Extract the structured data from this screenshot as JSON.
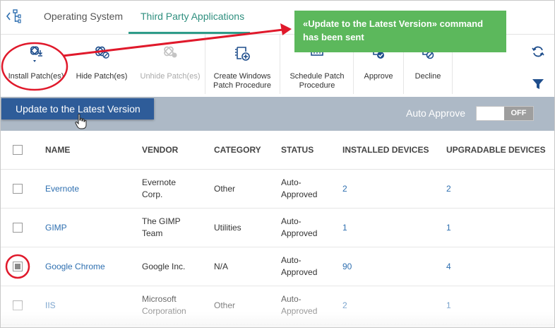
{
  "tabs": [
    {
      "label": "Operating System",
      "active": false
    },
    {
      "label": "Third Party Applications",
      "active": true
    }
  ],
  "toolbar": {
    "items": [
      {
        "label": "Install Patch(es)",
        "icon": "install-patch-icon",
        "disabled": false
      },
      {
        "label": "Hide Patch(es)",
        "icon": "hide-patch-icon",
        "disabled": false
      },
      {
        "label": "Unhide Patch(es)",
        "icon": "unhide-patch-icon",
        "disabled": true
      },
      {
        "label": "Create Windows Patch Procedure",
        "icon": "create-procedure-icon",
        "disabled": false
      },
      {
        "label": "Schedule Patch Procedure",
        "icon": "schedule-icon",
        "disabled": false
      },
      {
        "label": "Approve",
        "icon": "approve-icon",
        "disabled": false
      },
      {
        "label": "Decline",
        "icon": "decline-icon",
        "disabled": false
      }
    ]
  },
  "banner": {
    "update_button": "Update to the Latest Version",
    "auto_approve_label": "Auto Approve",
    "toggle_label": "OFF"
  },
  "table": {
    "headers": [
      "NAME",
      "VENDOR",
      "CATEGORY",
      "STATUS",
      "INSTALLED DEVICES",
      "UPGRADABLE DEVICES"
    ],
    "rows": [
      {
        "checked": false,
        "name": "Evernote",
        "vendor": [
          "Evernote",
          "Corp."
        ],
        "category": "Other",
        "status": [
          "Auto-",
          "Approved"
        ],
        "installed": "2",
        "upgradable": "2"
      },
      {
        "checked": false,
        "name": "GIMP",
        "vendor": [
          "The GIMP",
          "Team"
        ],
        "category": "Utilities",
        "status": [
          "Auto-",
          "Approved"
        ],
        "installed": "1",
        "upgradable": "1"
      },
      {
        "checked": true,
        "name": "Google Chrome",
        "vendor": [
          "Google Inc."
        ],
        "category": "N/A",
        "status": [
          "Auto-",
          "Approved"
        ],
        "installed": "90",
        "upgradable": "4"
      },
      {
        "checked": false,
        "name": "IIS",
        "vendor": [
          "Microsoft",
          "Corporation"
        ],
        "category": "Other",
        "status": [
          "Auto-",
          "Approved"
        ],
        "installed": "2",
        "upgradable": "1"
      }
    ]
  },
  "toast": {
    "text": "«Update to the Latest Version» command has been sent"
  },
  "colors": {
    "accent_tab": "#2f9c8a",
    "banner": "#adb9c6",
    "update_button": "#2e5c99",
    "toast": "#5cb85c",
    "annotation": "#e0192b",
    "link": "#2e6fb0"
  }
}
